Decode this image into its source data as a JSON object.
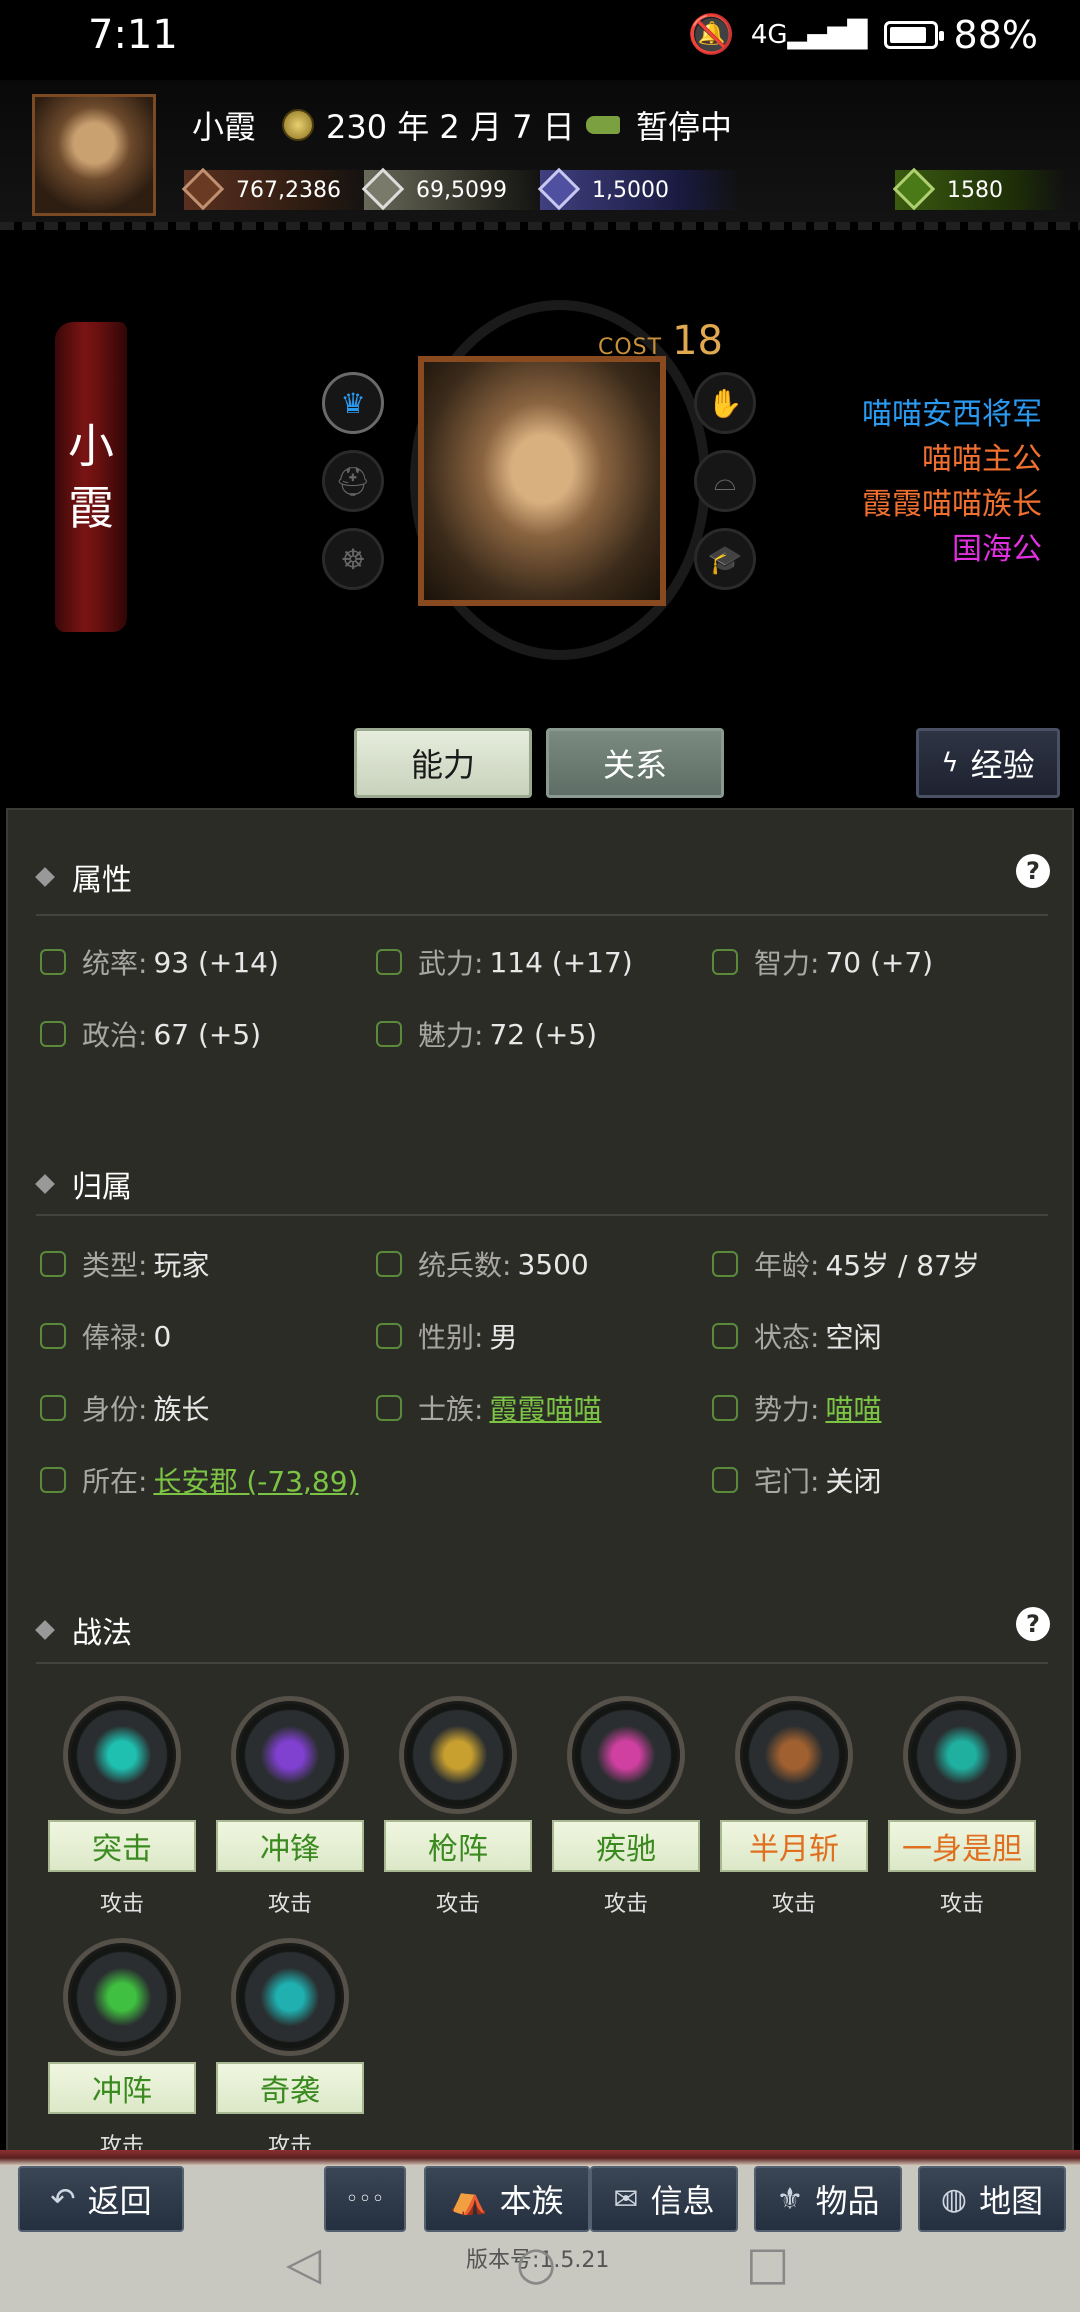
{
  "status_bar": {
    "time": "7:11",
    "battery": "88%",
    "battery_level": 0.88
  },
  "header": {
    "name": "小霞",
    "date": "230 年 2 月 7 日",
    "state": "暂停中",
    "resources": [
      "767,2386",
      "69,5099",
      "1,5000",
      "1580"
    ]
  },
  "character": {
    "name_chars": [
      "小",
      "霞"
    ],
    "cost_label": "COST",
    "cost_value": "18",
    "titles": [
      {
        "text": "喵喵安西将军",
        "color": "#2a9af0"
      },
      {
        "text": "喵喵主公",
        "color": "#f07030"
      },
      {
        "text": "霞霞喵喵族长",
        "color": "#f07030"
      },
      {
        "text": "国海公",
        "color": "#e030e0"
      }
    ]
  },
  "tabs": {
    "ability": "能力",
    "relation": "关系",
    "experience": "经验"
  },
  "sections": {
    "attributes": {
      "title": "属性",
      "items": [
        {
          "label": "统率:",
          "value": "93 (+14)"
        },
        {
          "label": "武力:",
          "value": "114 (+17)"
        },
        {
          "label": "智力:",
          "value": "70 (+7)"
        },
        {
          "label": "政治:",
          "value": "67 (+5)"
        },
        {
          "label": "魅力:",
          "value": "72 (+5)"
        }
      ]
    },
    "affiliation": {
      "title": "归属",
      "items": [
        {
          "label": "类型:",
          "value": "玩家"
        },
        {
          "label": "统兵数:",
          "value": "3500"
        },
        {
          "label": "年龄:",
          "value": "45岁 / 87岁"
        },
        {
          "label": "俸禄:",
          "value": "0"
        },
        {
          "label": "性别:",
          "value": "男"
        },
        {
          "label": "状态:",
          "value": "空闲"
        },
        {
          "label": "身份:",
          "value": "族长"
        },
        {
          "label": "士族:",
          "value": "霞霞喵喵"
        },
        {
          "label": "势力:",
          "value": "喵喵"
        },
        {
          "label": "所在:",
          "value": "长安郡 (-73,89)"
        },
        {
          "label": "宅门:",
          "value": "关闭"
        }
      ]
    },
    "tactics": {
      "title": "战法",
      "skills": [
        {
          "name": "突击",
          "type": "攻击",
          "color": "#20c0b0"
        },
        {
          "name": "冲锋",
          "type": "攻击",
          "color": "#8040d0"
        },
        {
          "name": "枪阵",
          "type": "攻击",
          "color": "#c8a030"
        },
        {
          "name": "疾驰",
          "type": "攻击",
          "color": "#d040a0"
        },
        {
          "name": "半月斩",
          "type": "攻击",
          "color": "#a06030"
        },
        {
          "name": "一身是胆",
          "type": "攻击",
          "color": "#20b0a0"
        },
        {
          "name": "冲阵",
          "type": "攻击",
          "color": "#40c040"
        },
        {
          "name": "奇袭",
          "type": "攻击",
          "color": "#20b0b0"
        }
      ]
    }
  },
  "bottom_nav": {
    "back": "返回",
    "more": "◦◦◦",
    "clan": "本族",
    "info": "信息",
    "items": "物品",
    "map": "地图",
    "version": "版本号:1.5.21"
  }
}
